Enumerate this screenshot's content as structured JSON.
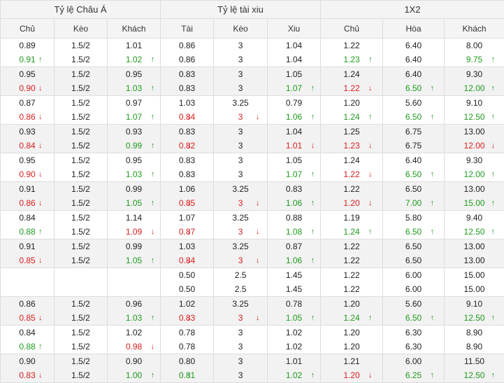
{
  "groups": [
    "Tỷ lệ Châu Á",
    "Tỷ lệ tài xiu",
    "1X2"
  ],
  "columns": [
    "Chủ",
    "Kèo",
    "Khách",
    "Tài",
    "Kèo",
    "Xiu",
    "Chủ",
    "Hòa",
    "Khách"
  ],
  "colors": {
    "up": "#1e9a1e",
    "down": "#d81e1e",
    "header_bg": "#f4f4f4",
    "alt_row_bg": "#f2f2f2"
  },
  "icons": {
    "up": "arrow-up-icon",
    "down": "arrow-down-icon"
  },
  "rows": [
    [
      [
        "0.89",
        "0.91+"
      ],
      [
        "1.5/2",
        "1.5/2"
      ],
      [
        "1.01",
        "1.02+"
      ],
      [
        "0.86",
        "0.86"
      ],
      [
        "3",
        "3"
      ],
      [
        "1.04",
        "1.04"
      ],
      [
        "1.22",
        "1.23+"
      ],
      [
        "6.40",
        "6.40"
      ],
      [
        "8.00",
        "9.75+"
      ]
    ],
    [
      [
        "0.95",
        "0.90-"
      ],
      [
        "1.5/2",
        "1.5/2"
      ],
      [
        "0.95",
        "1.03+"
      ],
      [
        "0.83",
        "0.83"
      ],
      [
        "3",
        "3"
      ],
      [
        "1.05",
        "1.07+"
      ],
      [
        "1.24",
        "1.22-"
      ],
      [
        "6.40",
        "6.50+"
      ],
      [
        "9.30",
        "12.00+"
      ]
    ],
    [
      [
        "0.87",
        "0.86-"
      ],
      [
        "1.5/2",
        "1.5/2"
      ],
      [
        "0.97",
        "1.07+"
      ],
      [
        "1.03",
        "0.84-"
      ],
      [
        "3.25",
        "3-"
      ],
      [
        "0.79",
        "1.06+"
      ],
      [
        "1.20",
        "1.24+"
      ],
      [
        "5.60",
        "6.50+"
      ],
      [
        "9.10",
        "12.50+"
      ]
    ],
    [
      [
        "0.93",
        "0.84-"
      ],
      [
        "1.5/2",
        "1.5/2"
      ],
      [
        "0.93",
        "0.99+"
      ],
      [
        "0.83",
        "0.82-"
      ],
      [
        "3",
        "3"
      ],
      [
        "1.04",
        "1.01-"
      ],
      [
        "1.25",
        "1.23-"
      ],
      [
        "6.75",
        "6.75"
      ],
      [
        "13.00",
        "12.00-"
      ]
    ],
    [
      [
        "0.95",
        "0.90-"
      ],
      [
        "1.5/2",
        "1.5/2"
      ],
      [
        "0.95",
        "1.03+"
      ],
      [
        "0.83",
        "0.83"
      ],
      [
        "3",
        "3"
      ],
      [
        "1.05",
        "1.07+"
      ],
      [
        "1.24",
        "1.22-"
      ],
      [
        "6.40",
        "6.50+"
      ],
      [
        "9.30",
        "12.00+"
      ]
    ],
    [
      [
        "0.91",
        "0.86-"
      ],
      [
        "1.5/2",
        "1.5/2"
      ],
      [
        "0.99",
        "1.05+"
      ],
      [
        "1.06",
        "0.85-"
      ],
      [
        "3.25",
        "3-"
      ],
      [
        "0.83",
        "1.06+"
      ],
      [
        "1.22",
        "1.20-"
      ],
      [
        "6.50",
        "7.00+"
      ],
      [
        "13.00",
        "15.00+"
      ]
    ],
    [
      [
        "0.84",
        "0.88+"
      ],
      [
        "1.5/2",
        "1.5/2"
      ],
      [
        "1.14",
        "1.09-"
      ],
      [
        "1.07",
        "0.87-"
      ],
      [
        "3.25",
        "3-"
      ],
      [
        "0.88",
        "1.08+"
      ],
      [
        "1.19",
        "1.24+"
      ],
      [
        "5.80",
        "6.50+"
      ],
      [
        "9.40",
        "12.50+"
      ]
    ],
    [
      [
        "0.91",
        "0.85-"
      ],
      [
        "1.5/2",
        "1.5/2"
      ],
      [
        "0.99",
        "1.05+"
      ],
      [
        "1.03",
        "0.84-"
      ],
      [
        "3.25",
        "3-"
      ],
      [
        "0.87",
        "1.06+"
      ],
      [
        "1.22",
        "1.22"
      ],
      [
        "6.50",
        "6.50"
      ],
      [
        "13.00",
        "13.00"
      ]
    ],
    [
      [
        "",
        ""
      ],
      [
        "",
        ""
      ],
      [
        "",
        ""
      ],
      [
        "0.50",
        "0.50"
      ],
      [
        "2.5",
        "2.5"
      ],
      [
        "1.45",
        "1.45"
      ],
      [
        "1.22",
        "1.22"
      ],
      [
        "6.00",
        "6.00"
      ],
      [
        "15.00",
        "15.00"
      ]
    ],
    [
      [
        "0.86",
        "0.85-"
      ],
      [
        "1.5/2",
        "1.5/2"
      ],
      [
        "0.96",
        "1.03+"
      ],
      [
        "1.02",
        "0.83-"
      ],
      [
        "3.25",
        "3-"
      ],
      [
        "0.78",
        "1.05+"
      ],
      [
        "1.20",
        "1.24+"
      ],
      [
        "5.60",
        "6.50+"
      ],
      [
        "9.10",
        "12.50+"
      ]
    ],
    [
      [
        "0.84",
        "0.88+"
      ],
      [
        "1.5/2",
        "1.5/2"
      ],
      [
        "1.02",
        "0.98-"
      ],
      [
        "0.78",
        "0.78"
      ],
      [
        "3",
        "3"
      ],
      [
        "1.02",
        "1.02"
      ],
      [
        "1.20",
        "1.20"
      ],
      [
        "6.30",
        "6.30"
      ],
      [
        "8.90",
        "8.90"
      ]
    ],
    [
      [
        "0.90",
        "0.83-"
      ],
      [
        "1.5/2",
        "1.5/2"
      ],
      [
        "0.90",
        "1.00+"
      ],
      [
        "0.80",
        "0.81+"
      ],
      [
        "3",
        "3"
      ],
      [
        "1.01",
        "1.02+"
      ],
      [
        "1.21",
        "1.20-"
      ],
      [
        "6.00",
        "6.25+"
      ],
      [
        "11.50",
        "12.50+"
      ]
    ]
  ]
}
